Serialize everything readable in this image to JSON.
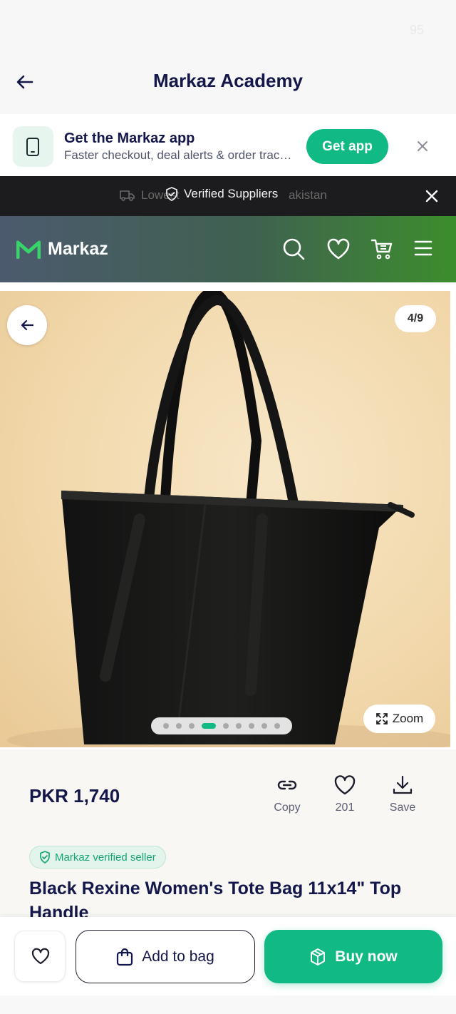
{
  "status_bar": {
    "faint_text": "95"
  },
  "header": {
    "title": "Markaz Academy"
  },
  "app_banner": {
    "title": "Get the Markaz app",
    "subtitle": "Faster checkout, deal alerts & order tracking",
    "cta": "Get app"
  },
  "promo_bar": {
    "ghost_left": "Lowest",
    "message": "Verified Suppliers",
    "ghost_right": "akistan"
  },
  "nav": {
    "brand": "Markaz",
    "icons": [
      "search-icon",
      "heart-icon",
      "cart-icon",
      "menu-icon"
    ]
  },
  "gallery": {
    "counter": "4/9",
    "total_images": 9,
    "active_index": 4,
    "zoom_label": "Zoom"
  },
  "product": {
    "price": "PKR 1,740",
    "actions": {
      "copy": "Copy",
      "likes": "201",
      "save": "Save"
    },
    "badge": "Markaz verified seller",
    "title": "Black Rexine Women's Tote Bag 11x14\" Top Handle"
  },
  "bottom_bar": {
    "add_to_bag": "Add to bag",
    "buy_now": "Buy now"
  },
  "colors": {
    "accent": "#11b984",
    "navy": "#13174a",
    "promo_bg": "#1c1c1e"
  }
}
